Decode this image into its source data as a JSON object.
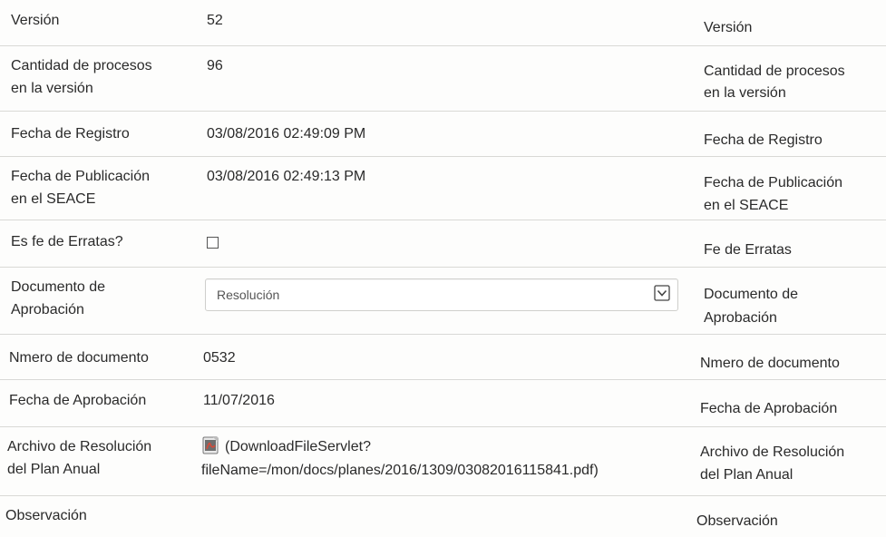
{
  "rows": [
    {
      "label": "Versión",
      "value": "52",
      "right": "Versión"
    },
    {
      "label1": "Cantidad de procesos",
      "label2": "en la versión",
      "value": "96",
      "right1": "Cantidad de procesos",
      "right2": "en la versión"
    },
    {
      "label": "Fecha de Registro",
      "value": "03/08/2016 02:49:09 PM",
      "right": "Fecha de Registro"
    },
    {
      "label1": "Fecha de Publicación",
      "label2": "en el SEACE",
      "value": "03/08/2016 02:49:13 PM",
      "right1": "Fecha de Publicación",
      "right2": "en el SEACE"
    },
    {
      "label": "Es fe de Erratas?",
      "checked": false,
      "right": "Fe de Erratas"
    },
    {
      "label1": "Documento de",
      "label2": "Aprobación",
      "select_value": "Resolución",
      "right1": "Documento de",
      "right2": "Aprobación"
    },
    {
      "label": "Nmero de documento",
      "value": "0532",
      "right": "Nmero de documento"
    },
    {
      "label": "Fecha de Aprobación",
      "value": "11/07/2016",
      "right": "Fecha de Aprobación"
    },
    {
      "label1": "Archivo de Resolución",
      "label2": "del Plan Anual",
      "file_line1": "(DownloadFileServlet?",
      "file_line2": "fileName=/mon/docs/planes/2016/1309/03082016115841.pdf)",
      "right1": "Archivo de Resolución",
      "right2": "del Plan Anual"
    },
    {
      "label": "Observación",
      "value": "",
      "right": "Observación"
    }
  ],
  "icons": {
    "pdf": "pdf-file-icon",
    "dropdown": "chevron-down-icon"
  },
  "colors": {
    "border": "#d9d9d6",
    "text": "#2a2a2a",
    "pdf_red": "#c0392b"
  }
}
